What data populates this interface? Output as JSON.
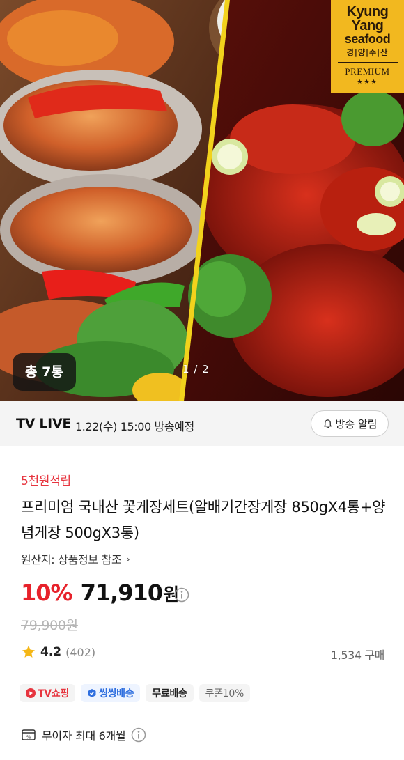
{
  "hero": {
    "count_badge": "총 7통",
    "pager": "1 / 2",
    "logo": {
      "line1": "Kyung",
      "line2": "Yang",
      "line3": "seafood",
      "line4": "경|양|수|산",
      "line5": "PREMIUM",
      "stars": "★★★"
    }
  },
  "live": {
    "label": "TV LIVE",
    "schedule": "1.22(수) 15:00 방송예정",
    "alarm_button": "방송 알림"
  },
  "product": {
    "reward": "5천원적립",
    "title": "프리미엄 국내산 꽃게장세트(알배기간장게장 850gX4통+양념게장 500gX3통)",
    "origin": "원산지: 상품정보 참조",
    "discount": "10%",
    "price": "71,910",
    "currency": "원",
    "original_price": "79,900원",
    "rating": "4.2",
    "review_count": "(402)",
    "purchase_count": "1,534 구매"
  },
  "tags": {
    "tv_shopping": "TV쇼핑",
    "fast_delivery": "씽씽배송",
    "free_shipping": "무료배송",
    "coupon": "쿠폰10%"
  },
  "installment": {
    "text": "무이자 최대 6개월"
  },
  "colors": {
    "accent_red": "#e7222b",
    "logo_gold": "#f2b81f",
    "fast_blue": "#2f6fdf"
  }
}
